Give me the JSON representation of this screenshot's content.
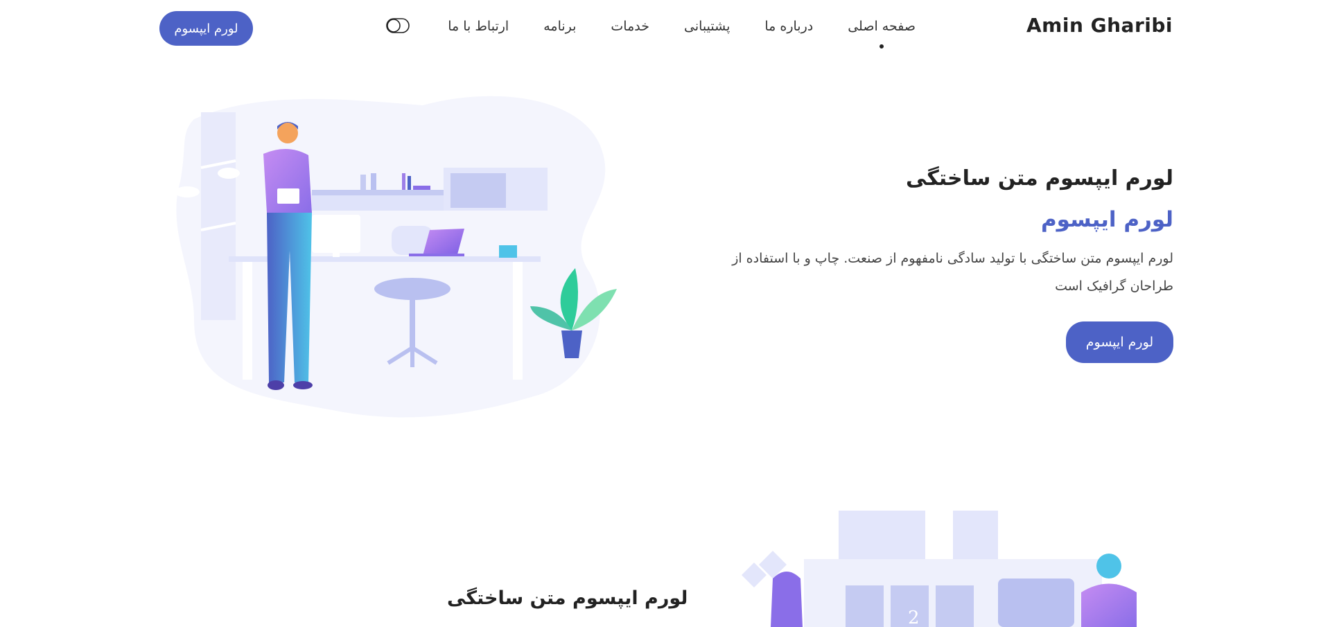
{
  "header": {
    "brand": "Amin Gharibi",
    "nav": [
      "صفحه اصلی",
      "درباره ما",
      "پشتیبانی",
      "خدمات",
      "برنامه",
      "ارتباط با ما"
    ],
    "active_index": 0,
    "toggle_icon": "toggle-icon",
    "button_label": "لورم ایپسوم"
  },
  "hero": {
    "title": "لورم ایپسوم متن ساختگی",
    "subtitle": "لورم ایپسوم",
    "description": "لورم ایپسوم متن ساختگی با تولید سادگی نامفهوم از صنعت. چاپ و با استفاده از طراحان گرافیک است",
    "button_label": "لورم ایپسوم"
  },
  "section2": {
    "title": "لورم ایپسوم متن ساختگی",
    "board_number": "2"
  },
  "colors": {
    "accent": "#4d62c6",
    "text": "#222222",
    "illustration": "#c5cbf2"
  }
}
